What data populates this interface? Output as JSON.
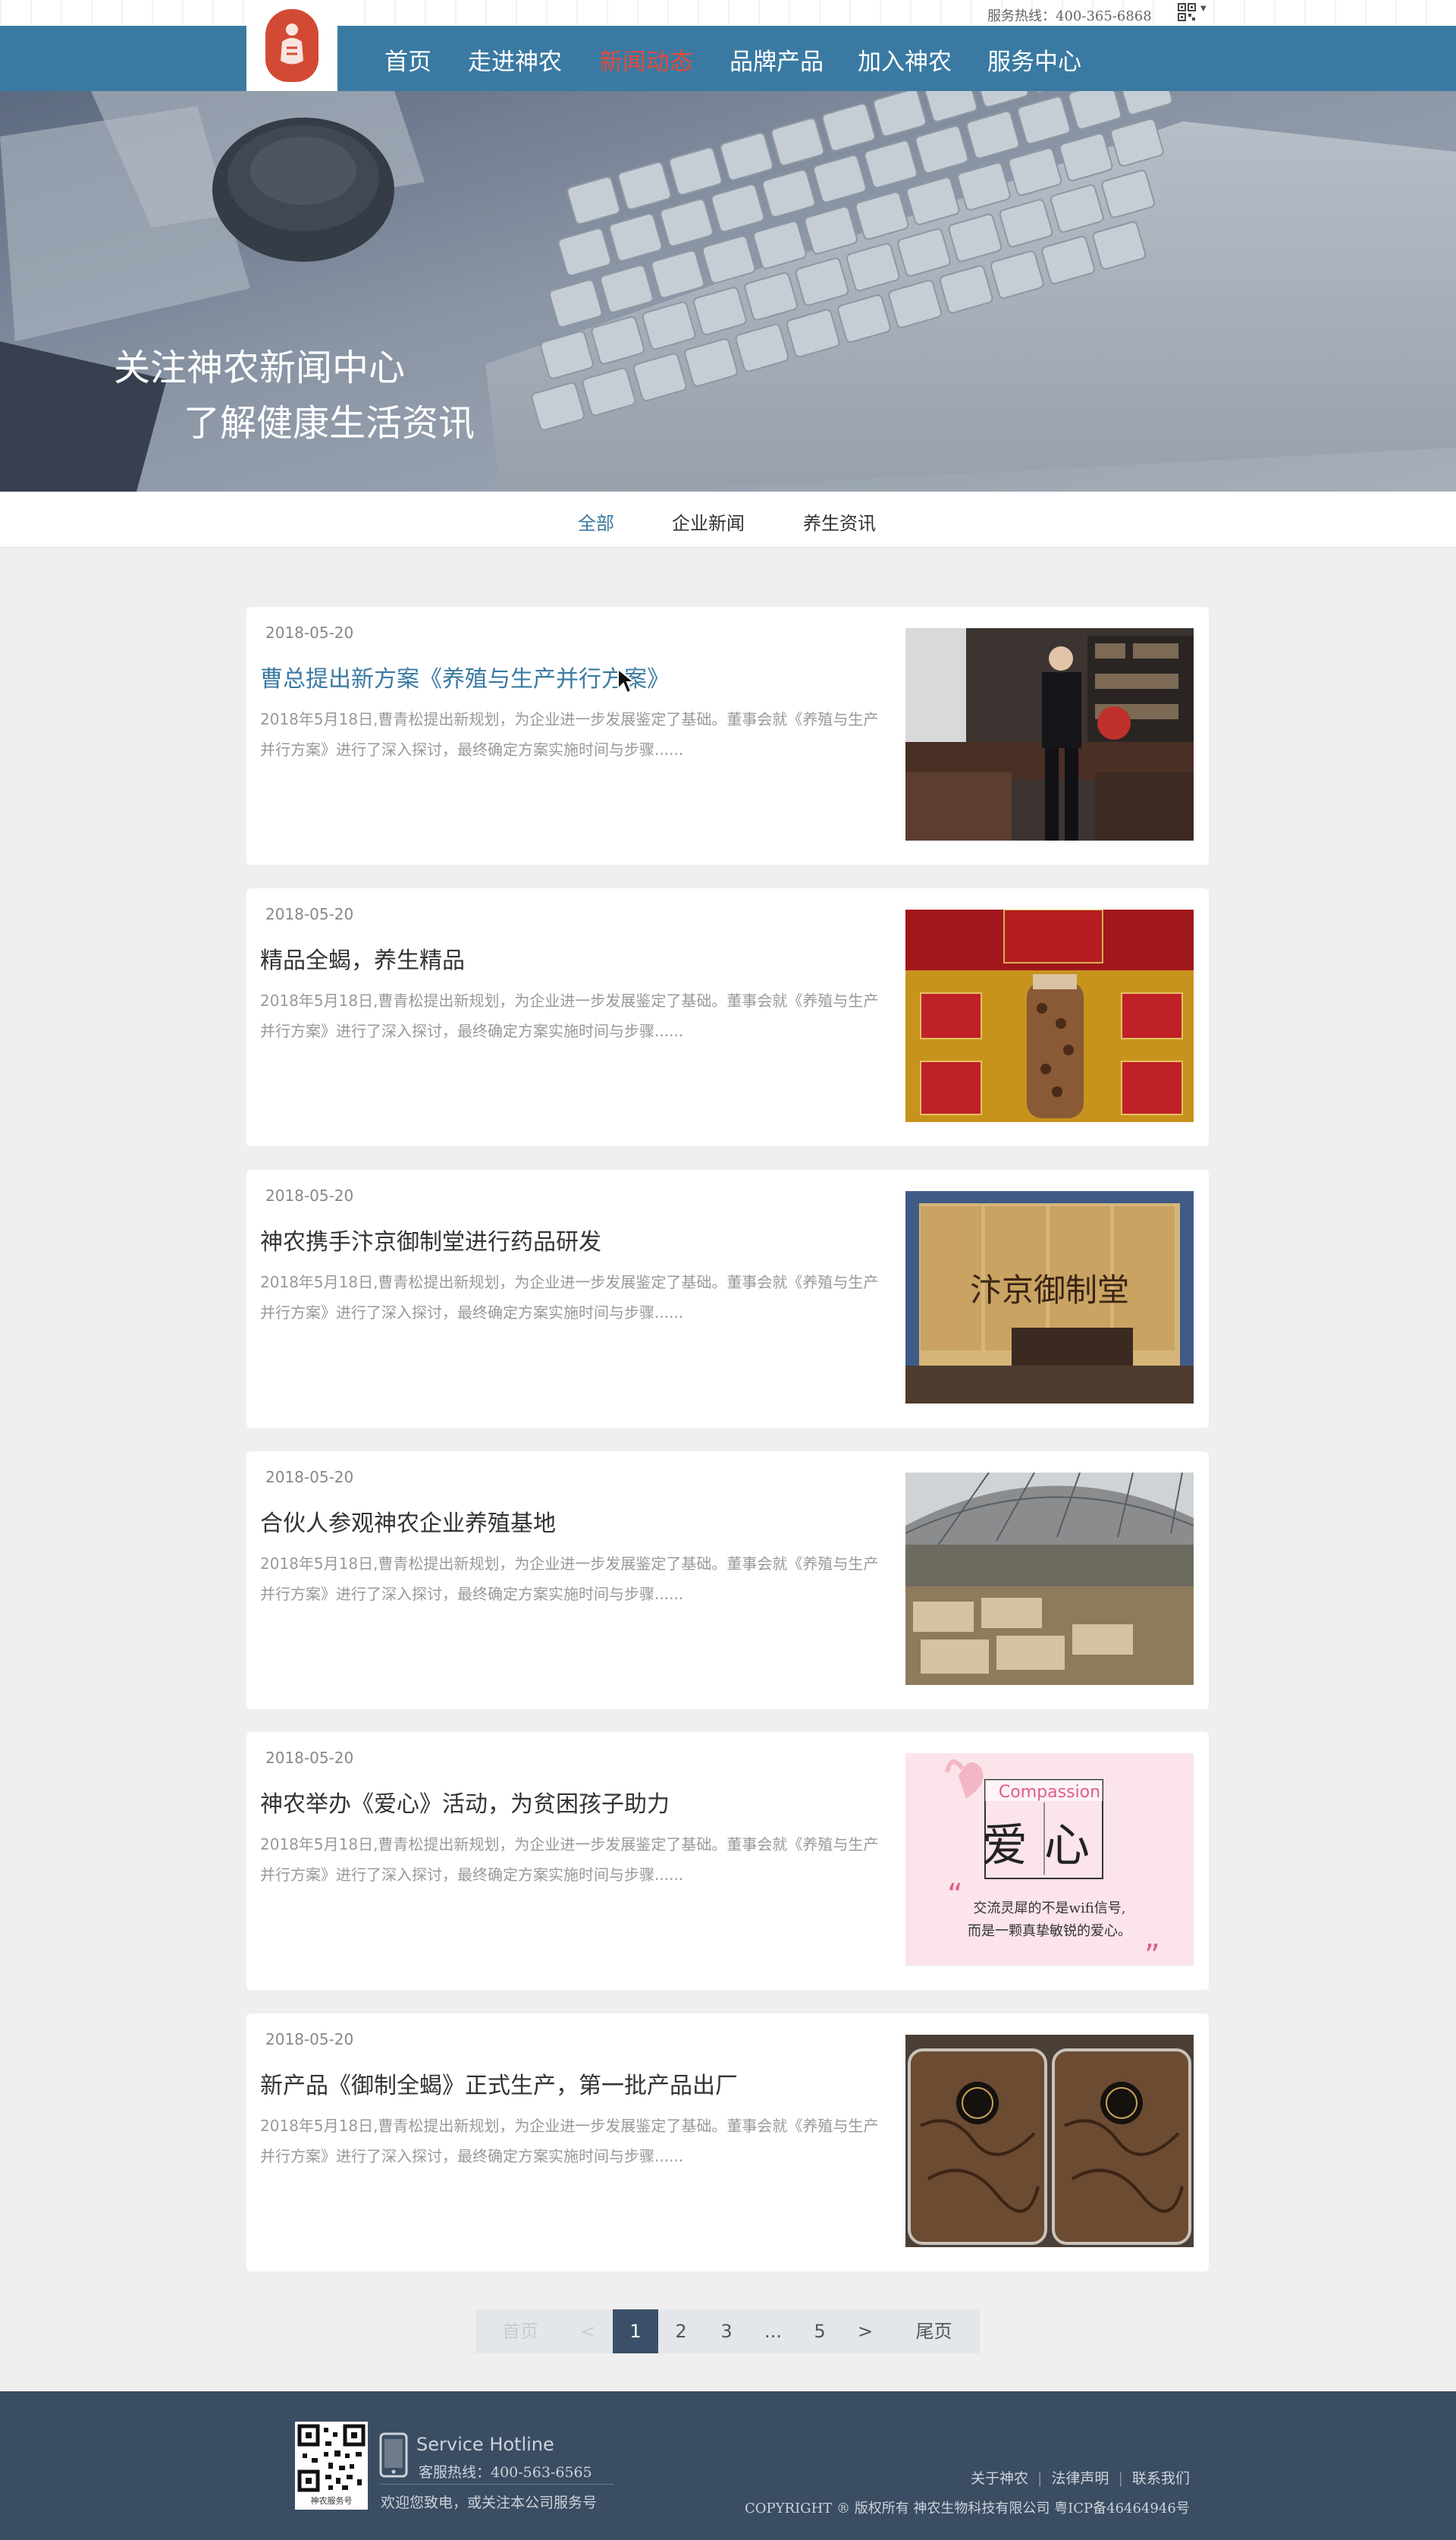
{
  "topbar": {
    "hotline": "服务热线：400-365-6868"
  },
  "nav": {
    "items": [
      {
        "label": "首页"
      },
      {
        "label": "走进神农"
      },
      {
        "label": "新闻动态"
      },
      {
        "label": "品牌产品"
      },
      {
        "label": "加入神农"
      },
      {
        "label": "服务中心"
      }
    ],
    "active_index": 2
  },
  "banner": {
    "line1": "关注神农新闻中心",
    "line2": "了解健康生活资讯"
  },
  "tabs": [
    {
      "label": "全部"
    },
    {
      "label": "企业新闻"
    },
    {
      "label": "养生资讯"
    }
  ],
  "articles": [
    {
      "date": "2018-05-20",
      "title": "曹总提出新方案《养殖与生产并行方案》",
      "summary": "2018年5月18日,曹青松提出新规划，为企业进一步发展鉴定了基础。董事会就《养殖与生产并行方案》进行了深入探讨，最终确定方案实施时间与步骤......"
    },
    {
      "date": "2018-05-20",
      "title": "精品全蝎，养生精品",
      "summary": "2018年5月18日,曹青松提出新规划，为企业进一步发展鉴定了基础。董事会就《养殖与生产并行方案》进行了深入探讨，最终确定方案实施时间与步骤......"
    },
    {
      "date": "2018-05-20",
      "title": "神农携手汴京御制堂进行药品研发",
      "summary": "2018年5月18日,曹青松提出新规划，为企业进一步发展鉴定了基础。董事会就《养殖与生产并行方案》进行了深入探讨，最终确定方案实施时间与步骤......"
    },
    {
      "date": "2018-05-20",
      "title": "合伙人参观神农企业养殖基地",
      "summary": "2018年5月18日,曹青松提出新规划，为企业进一步发展鉴定了基础。董事会就《养殖与生产并行方案》进行了深入探讨，最终确定方案实施时间与步骤......"
    },
    {
      "date": "2018-05-20",
      "title": "神农举办《爱心》活动，为贫困孩子助力",
      "summary": "2018年5月18日,曹青松提出新规划，为企业进一步发展鉴定了基础。董事会就《养殖与生产并行方案》进行了深入探讨，最终确定方案实施时间与步骤......"
    },
    {
      "date": "2018-05-20",
      "title": "新产品《御制全蝎》正式生产，第一批产品出厂",
      "summary": "2018年5月18日,曹青松提出新规划，为企业进一步发展鉴定了基础。董事会就《养殖与生产并行方案》进行了深入探讨，最终确定方案实施时间与步骤......"
    }
  ],
  "thumb_text": {
    "plaque": "汴京御制堂",
    "compassion_title": "Compassion",
    "compassion_chars": "爱心",
    "compassion_line1": "交流灵犀的不是wifi信号,",
    "compassion_line2": "而是一颗真挚敏锐的爱心。"
  },
  "pagination": {
    "first": "首页",
    "prev": "<",
    "pages": [
      "1",
      "2",
      "3",
      "...",
      "5"
    ],
    "next": ">",
    "last": "尾页",
    "current": 1
  },
  "footer": {
    "qr_caption": "神农服务号",
    "hotline_en": "Service Hotline",
    "hotline_cn": "客服热线：400-563-6565",
    "welcome": "欢迎您致电，或关注本公司服务号",
    "links": [
      "关于神农",
      "法律声明",
      "联系我们"
    ],
    "copyright": "COPYRIGHT ® 版权所有 神农生物科技有限公司 粤ICP备46464946号"
  },
  "colors": {
    "nav_bg": "#3a7aa2",
    "nav_active": "#e24b3b",
    "accent": "#3a7aa2",
    "footer_bg": "#3b4d63",
    "pager_current": "#3b5068"
  }
}
